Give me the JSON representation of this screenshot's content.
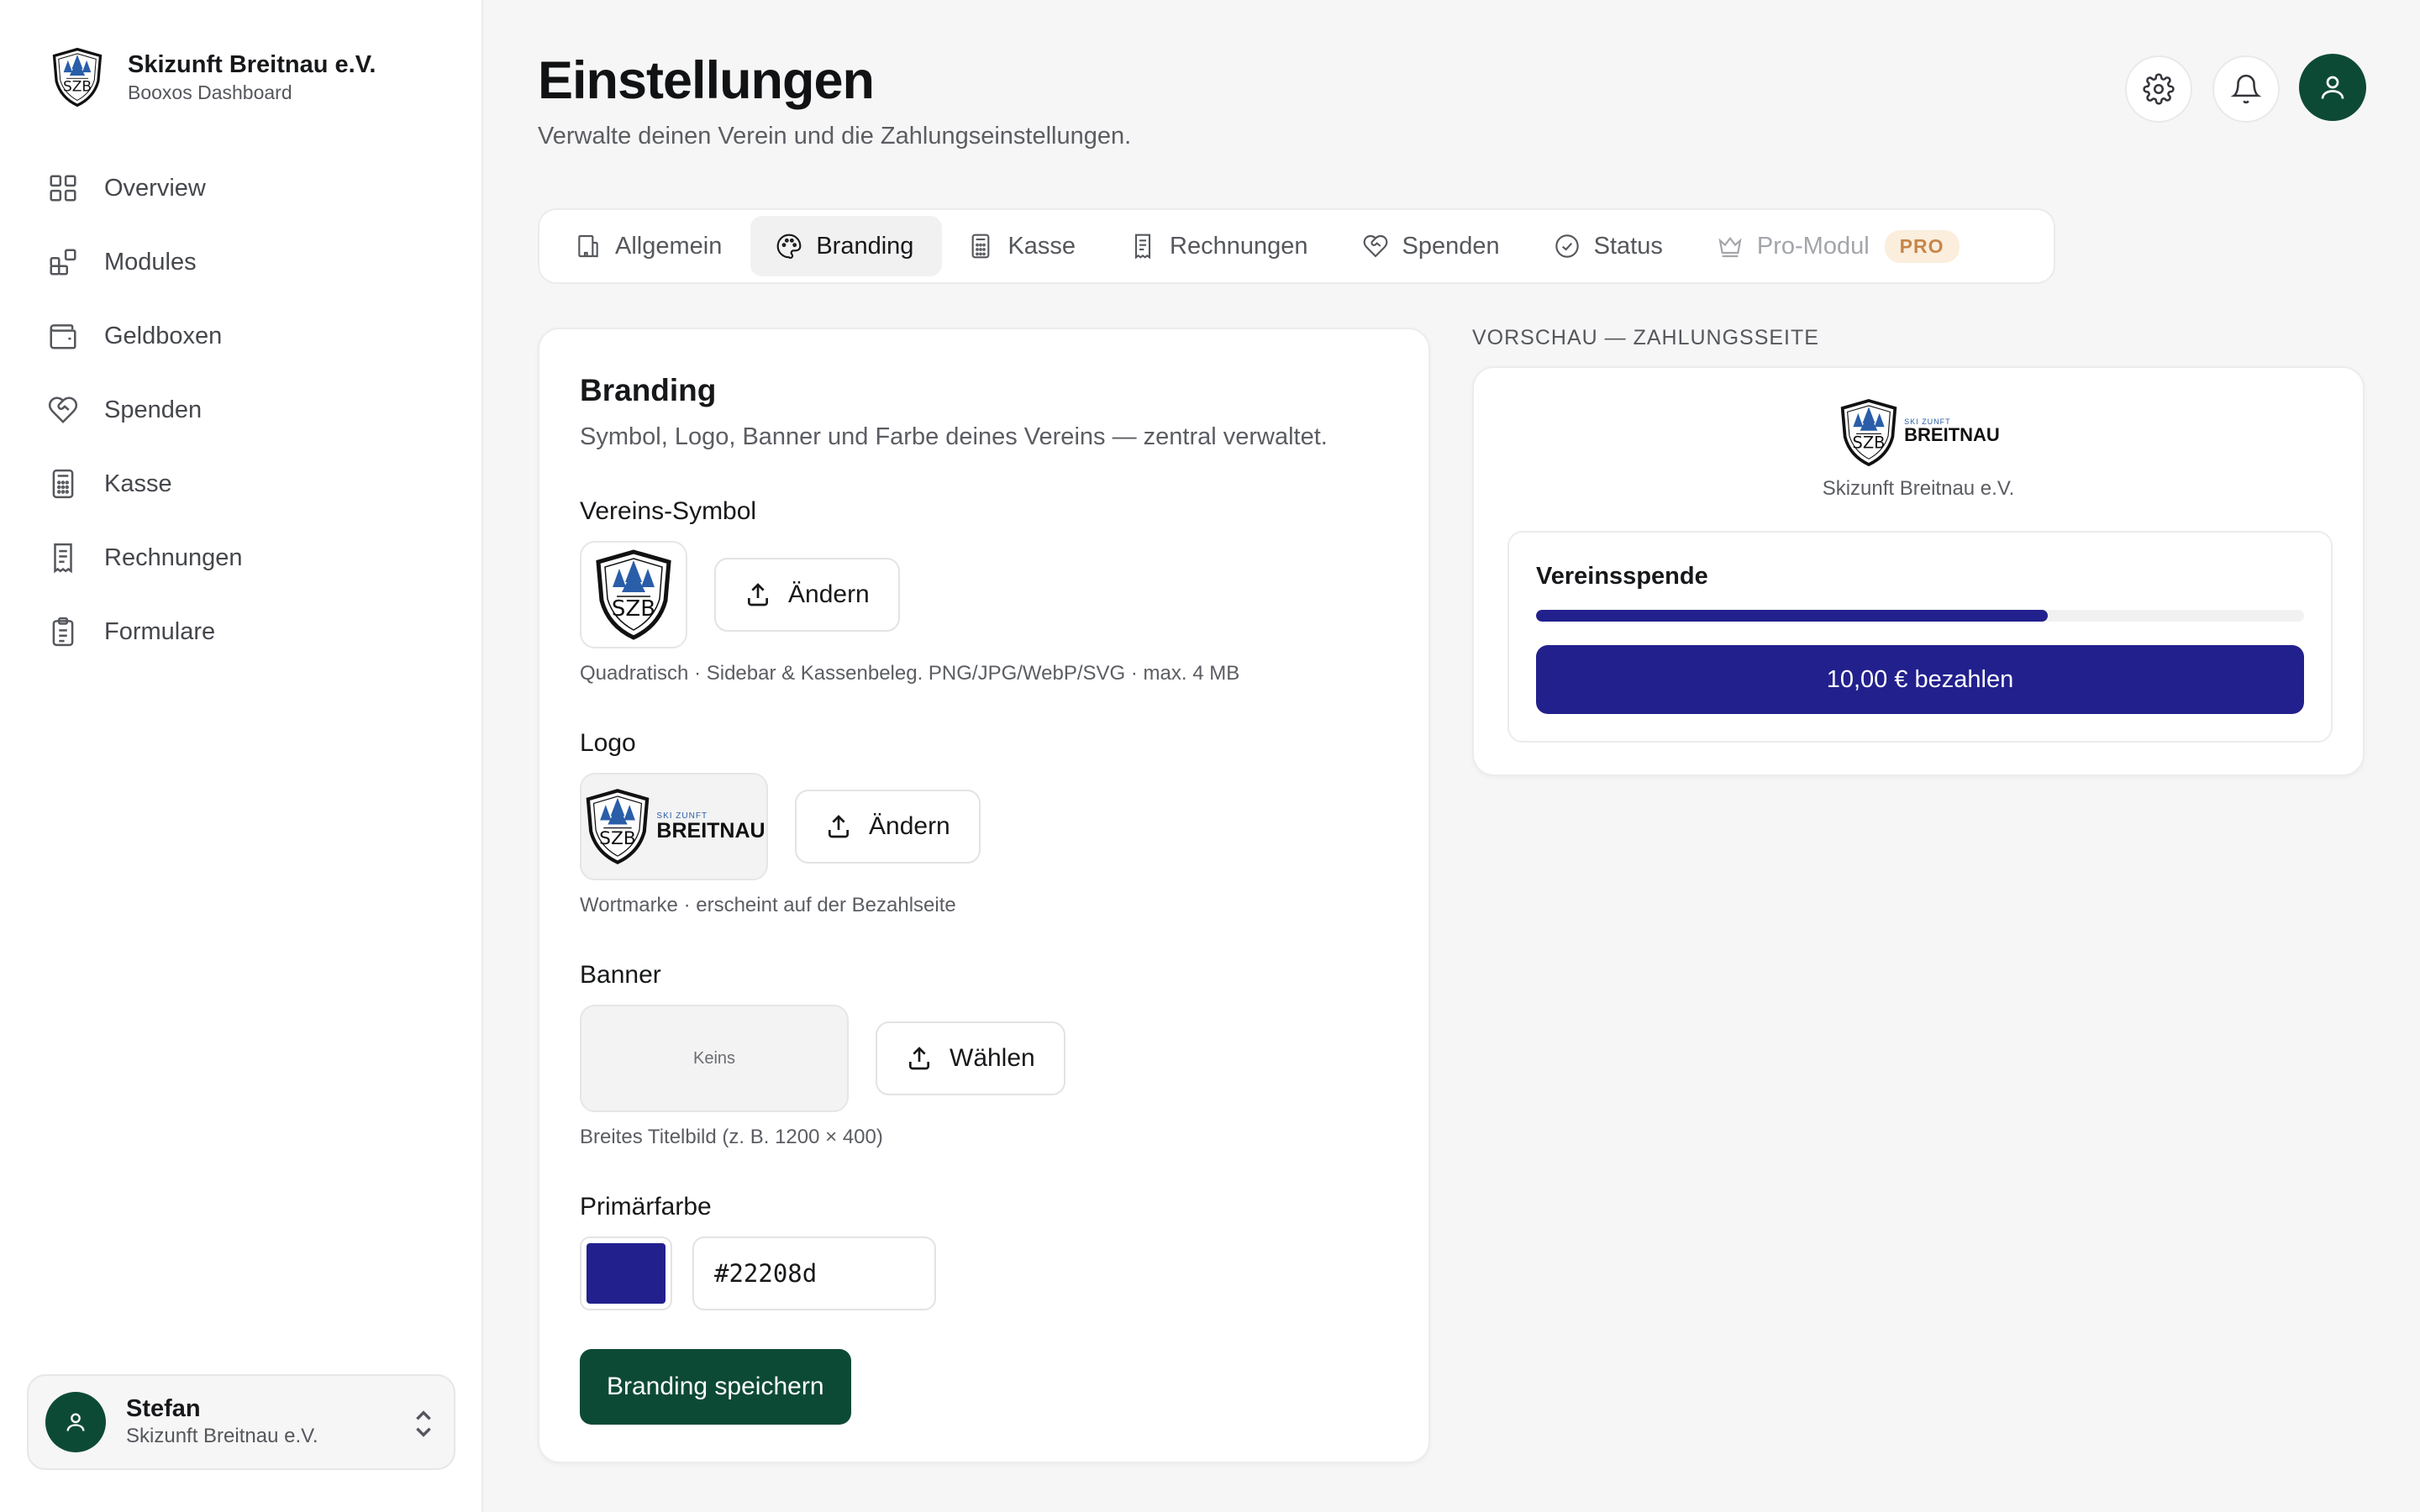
{
  "brand": {
    "name": "Skizunft Breitnau e.V.",
    "subtitle": "Booxos Dashboard"
  },
  "nav": [
    {
      "label": "Overview",
      "icon": "grid-icon"
    },
    {
      "label": "Modules",
      "icon": "modules-icon"
    },
    {
      "label": "Geldboxen",
      "icon": "wallet-icon"
    },
    {
      "label": "Spenden",
      "icon": "heart-handshake-icon"
    },
    {
      "label": "Kasse",
      "icon": "calculator-icon"
    },
    {
      "label": "Rechnungen",
      "icon": "receipt-icon"
    },
    {
      "label": "Formulare",
      "icon": "clipboard-icon"
    }
  ],
  "user": {
    "name": "Stefan",
    "club": "Skizunft Breitnau e.V."
  },
  "page": {
    "title": "Einstellungen",
    "subtitle": "Verwalte deinen Verein und die Zahlungseinstellungen."
  },
  "tabs": [
    {
      "label": "Allgemein",
      "icon": "building-icon",
      "state": "normal"
    },
    {
      "label": "Branding",
      "icon": "palette-icon",
      "state": "active"
    },
    {
      "label": "Kasse",
      "icon": "calculator-icon",
      "state": "normal"
    },
    {
      "label": "Rechnungen",
      "icon": "receipt-icon",
      "state": "normal"
    },
    {
      "label": "Spenden",
      "icon": "heart-handshake-icon",
      "state": "normal"
    },
    {
      "label": "Status",
      "icon": "check-circle-icon",
      "state": "normal"
    },
    {
      "label": "Pro-Modul",
      "icon": "crown-icon",
      "state": "muted",
      "badge": "PRO"
    }
  ],
  "branding": {
    "title": "Branding",
    "description": "Symbol, Logo, Banner und Farbe deines Vereins — zentral verwaltet.",
    "symbol": {
      "label": "Vereins-Symbol",
      "button": "Ändern",
      "hint": "Quadratisch · Sidebar & Kassenbeleg. PNG/JPG/WebP/SVG · max. 4 MB"
    },
    "logo": {
      "label": "Logo",
      "button": "Ändern",
      "hint": "Wortmarke · erscheint auf der Bezahlseite",
      "wordmark_small": "SKI ZUNFT",
      "wordmark": "BREITNAU"
    },
    "banner": {
      "label": "Banner",
      "placeholder": "Keins",
      "button": "Wählen",
      "hint": "Breites Titelbild (z. B. 1200 × 400)"
    },
    "color": {
      "label": "Primärfarbe",
      "value": "#22208d"
    },
    "save": "Branding speichern"
  },
  "preview": {
    "label": "VORSCHAU — ZAHLUNGSSEITE",
    "club_name": "Skizunft Breitnau e.V.",
    "campaign": "Vereinsspende",
    "progress": 0.666,
    "pay_button": "10,00 € bezahlen"
  },
  "colors": {
    "primary": "#22208d",
    "accent_green": "#0d4a36",
    "crest_blue": "#2a5ea8"
  }
}
